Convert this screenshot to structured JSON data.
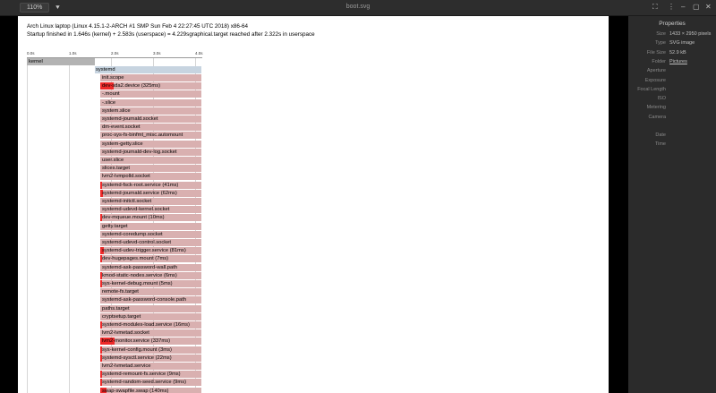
{
  "toolbar": {
    "zoom": "110%",
    "zoom_menu_glyph": "⯆",
    "title": "boot.svg"
  },
  "window": {
    "fullscreen_glyph": "⛶",
    "menu_glyph": "⋮",
    "minimize_glyph": "–",
    "maximize_glyph": "▢",
    "close_glyph": "✕"
  },
  "bootchart": {
    "header_line1": "Arch Linux laptop (Linux 4.15.1-2-ARCH #1 SMP Sun Feb 4 22:27:45 UTC 2018) x86-64",
    "header_line2": "Startup finished in 1.646s (kernel) + 2.583s (userspace) = 4.229sgraphical.target reached after 2.322s in userspace",
    "ticks": [
      "0.0s",
      "1.0s",
      "2.0s",
      "3.0s",
      "4.0s"
    ],
    "kernel_label": "kernel",
    "systemd_label": "systemd",
    "units": [
      {
        "label": "init.scope",
        "act": 0
      },
      {
        "label": "dev-sda2.device (325ms)",
        "act": 0.325
      },
      {
        "label": "-.mount",
        "act": 0
      },
      {
        "label": "-.slice",
        "act": 0
      },
      {
        "label": "system.slice",
        "act": 0
      },
      {
        "label": "systemd-journald.socket",
        "act": 0
      },
      {
        "label": "dm-event.socket",
        "act": 0
      },
      {
        "label": "proc-sys-fs-binfmt_misc.automount",
        "act": 0
      },
      {
        "label": "system-getty.slice",
        "act": 0
      },
      {
        "label": "systemd-journald-dev-log.socket",
        "act": 0
      },
      {
        "label": "user.slice",
        "act": 0
      },
      {
        "label": "slices.target",
        "act": 0
      },
      {
        "label": "lvm2-lvmpolld.socket",
        "act": 0
      },
      {
        "label": "systemd-fsck-root.service (41ms)",
        "act": 0.041
      },
      {
        "label": "systemd-journald.service (62ms)",
        "act": 0.062
      },
      {
        "label": "systemd-initctl.socket",
        "act": 0
      },
      {
        "label": "systemd-udevd-kernel.socket",
        "act": 0
      },
      {
        "label": "dev-mqueue.mount (10ms)",
        "act": 0.01
      },
      {
        "label": "getty.target",
        "act": 0
      },
      {
        "label": "systemd-coredump.socket",
        "act": 0
      },
      {
        "label": "systemd-udevd-control.socket",
        "act": 0
      },
      {
        "label": "systemd-udev-trigger.service (81ms)",
        "act": 0.081
      },
      {
        "label": "dev-hugepages.mount (7ms)",
        "act": 0.007
      },
      {
        "label": "systemd-ask-password-wall.path",
        "act": 0
      },
      {
        "label": "kmod-static-nodes.service (6ms)",
        "act": 0.006
      },
      {
        "label": "sys-kernel-debug.mount (5ms)",
        "act": 0.005
      },
      {
        "label": "remote-fs.target",
        "act": 0
      },
      {
        "label": "systemd-ask-password-console.path",
        "act": 0
      },
      {
        "label": "paths.target",
        "act": 0
      },
      {
        "label": "cryptsetup.target",
        "act": 0
      },
      {
        "label": "systemd-modules-load.service (16ms)",
        "act": 0.016
      },
      {
        "label": "lvm2-lvmetad.socket",
        "act": 0
      },
      {
        "label": "lvm2-monitor.service (337ms)",
        "act": 0.337
      },
      {
        "label": "sys-kernel-config.mount (3ms)",
        "act": 0.003
      },
      {
        "label": "systemd-sysctl.service (22ms)",
        "act": 0.022
      },
      {
        "label": "lvm2-lvmetad.service",
        "act": 0
      },
      {
        "label": "systemd-remount-fs.service (9ms)",
        "act": 0.009
      },
      {
        "label": "systemd-random-seed.service (9ms)",
        "act": 0.009
      },
      {
        "label": "swap-swapfile.swap (140ms)",
        "act": 0.14
      }
    ]
  },
  "properties": {
    "title": "Properties",
    "rows": [
      {
        "key": "Size",
        "value": "1433 × 2950 pixels"
      },
      {
        "key": "Type",
        "value": "SVG image"
      },
      {
        "key": "File Size",
        "value": "52.9 kB"
      },
      {
        "key": "Folder",
        "value": "Pictures",
        "link": true
      },
      {
        "key": "Aperture",
        "value": ""
      },
      {
        "key": "Exposure",
        "value": ""
      },
      {
        "key": "Focal Length",
        "value": ""
      },
      {
        "key": "ISO",
        "value": ""
      },
      {
        "key": "Metering",
        "value": ""
      },
      {
        "key": "Camera",
        "value": ""
      },
      {
        "key": "Date",
        "value": ""
      },
      {
        "key": "Time",
        "value": ""
      }
    ]
  },
  "colors": {
    "active": "#ee2a2a",
    "inactive": "#d9b0b0",
    "kernel": "#b3b3b3",
    "systemd": "#c7d4e0"
  }
}
